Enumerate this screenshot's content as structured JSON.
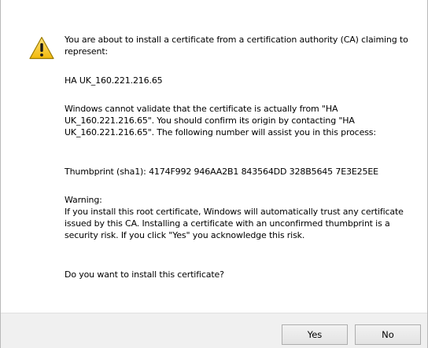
{
  "dialog": {
    "intro": "You are about to install a certificate from a certification authority (CA) claiming to represent:",
    "ca_name": "HA UK_160.221.216.65",
    "validate_msg": "Windows cannot validate that the certificate is actually from \"HA UK_160.221.216.65\". You should confirm its origin by contacting \"HA UK_160.221.216.65\". The following number will assist you in this process:",
    "thumbprint": "Thumbprint (sha1): 4174F992 946AA2B1 843564DD 328B5645 7E3E25EE",
    "warning_title": "Warning:",
    "warning_body": "If you install this root certificate, Windows will automatically trust any certificate issued by this CA. Installing a certificate with an unconfirmed thumbprint is a security risk. If you click \"Yes\" you acknowledge this risk.",
    "question": "Do you want to install this certificate?",
    "icon": "warning-triangle-icon"
  },
  "buttons": {
    "yes_label": "Yes",
    "no_label": "No"
  },
  "colors": {
    "footer_bg": "#f0f0f0",
    "icon_fill": "#f5c518",
    "icon_border": "#9a7a00"
  }
}
